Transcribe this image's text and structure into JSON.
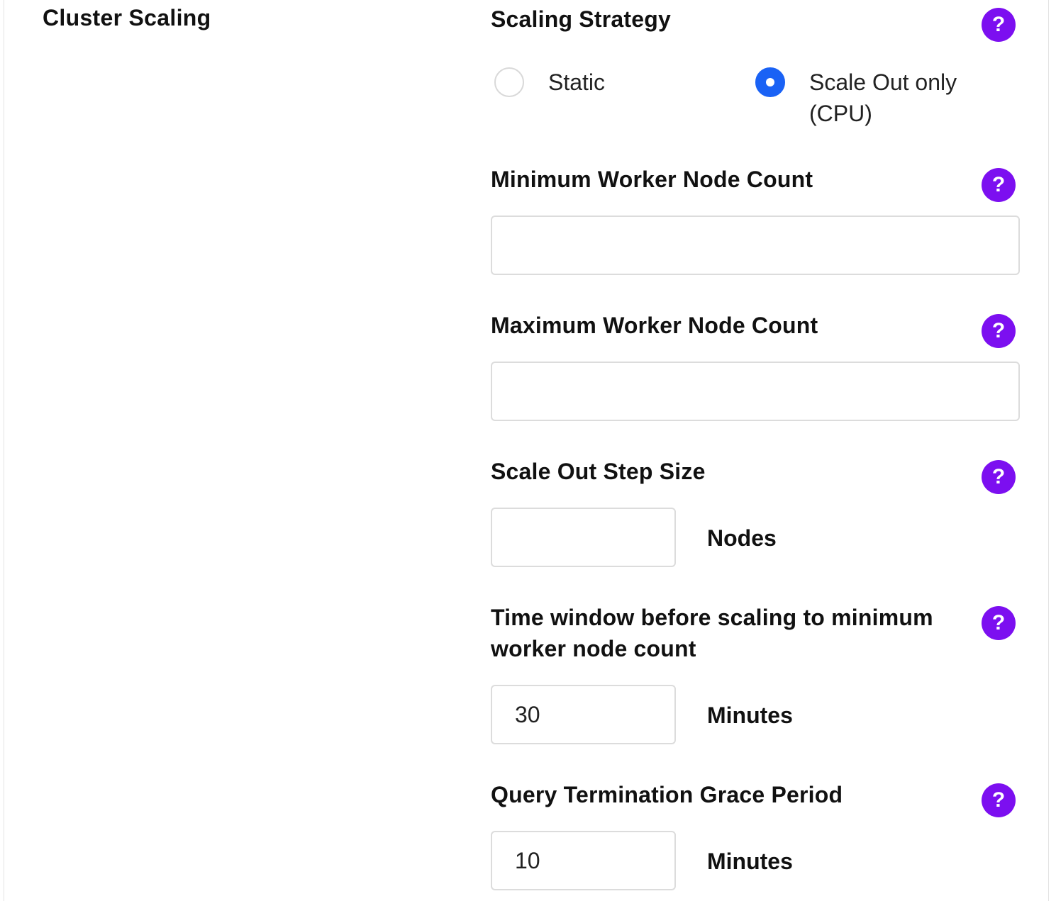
{
  "section": {
    "title": "Cluster Scaling"
  },
  "scaling_strategy": {
    "label": "Scaling Strategy",
    "help": "?",
    "options": [
      {
        "label": "Static",
        "selected": false
      },
      {
        "label_line1": "Scale Out only",
        "label_line2": "(CPU)",
        "selected": true
      }
    ]
  },
  "min_worker_nodes": {
    "label": "Minimum Worker Node Count",
    "help": "?",
    "value": ""
  },
  "max_worker_nodes": {
    "label": "Maximum Worker Node Count",
    "help": "?",
    "value": ""
  },
  "scale_out_step": {
    "label": "Scale Out Step Size",
    "help": "?",
    "value": "",
    "unit": "Nodes"
  },
  "time_window": {
    "label_line1": "Time window before scaling to minimum",
    "label_line2": "worker node count",
    "help": "?",
    "value": "30",
    "unit": "Minutes"
  },
  "grace_period": {
    "label": "Query Termination Grace Period",
    "help": "?",
    "value": "10",
    "unit": "Minutes"
  },
  "colors": {
    "help_button": "#7c0ff0",
    "radio_selected": "#1a62f5",
    "input_border": "#dcdcdc"
  }
}
